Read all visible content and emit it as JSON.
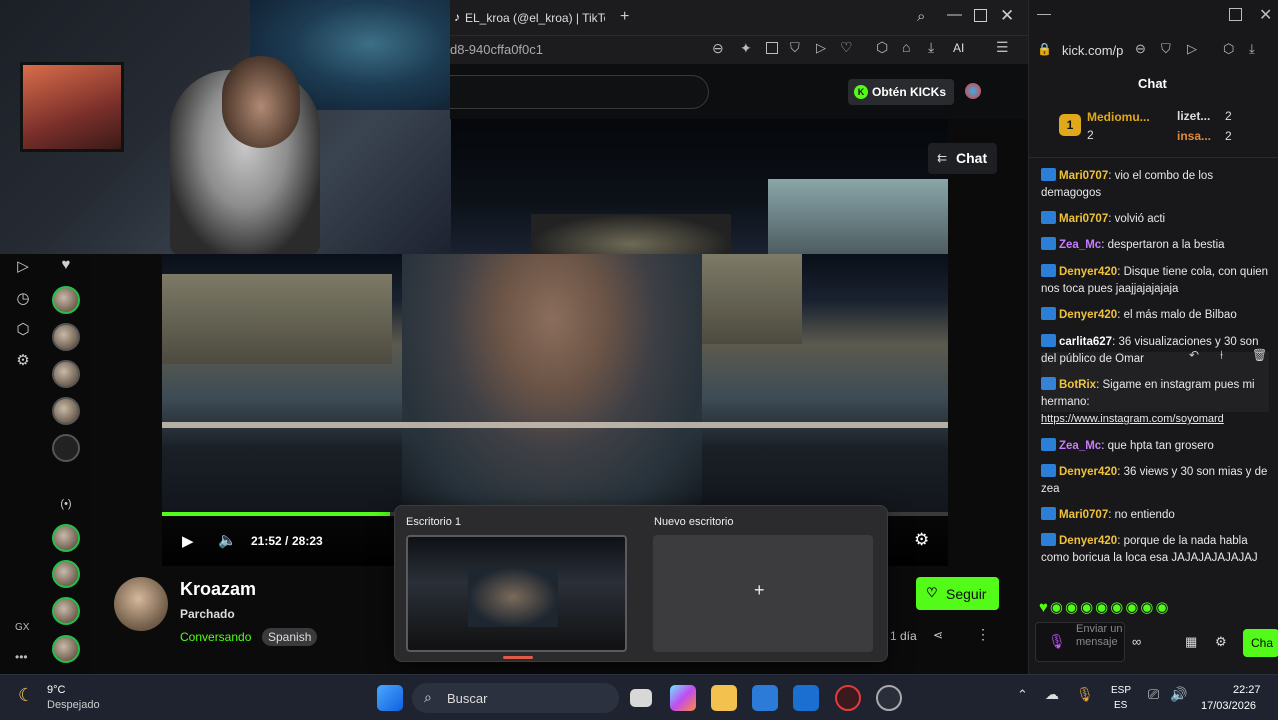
{
  "browser": {
    "tab_title": "EL_kroa (@el_kroa) | TikTo",
    "url_fragment": "d8-940cffa0f0c1",
    "ai_label": "AI"
  },
  "site": {
    "kicks_button": "Obtén KICKs",
    "chat_toggle": "Chat"
  },
  "player": {
    "current_time": "21:52",
    "separator": "/",
    "duration": "28:23",
    "progress": 0.29
  },
  "streamer": {
    "name": "Kroazam",
    "category": "Parchado",
    "status": "Conversando",
    "language": "Spanish",
    "follow": "Seguir",
    "age": "1 día"
  },
  "sidebar": {
    "gx": "GX"
  },
  "desktops": {
    "d1": "Escritorio 1",
    "d2": "Nuevo escritorio",
    "add": "+"
  },
  "chat": {
    "url": "kick.com/p",
    "title": "Chat",
    "leader": {
      "rank": "1",
      "name1": "Mediomu...",
      "count1": "2",
      "name2": "lizet...",
      "count2": "2",
      "name3": "insa...",
      "count3": "2"
    },
    "messages": [
      {
        "user": "Mari0707",
        "color": "#f0c23a",
        "text": "vio el combo de los demagogos"
      },
      {
        "user": "Mari0707",
        "color": "#f0c23a",
        "text": "volvió acti"
      },
      {
        "user": "Zea_Mc",
        "color": "#c77dff",
        "text": "despertaron a la bestia"
      },
      {
        "user": "Denyer420",
        "color": "#f0c23a",
        "text": "Disque tiene cola, con quien nos toca pues jaajjajajajaja"
      },
      {
        "user": "Denyer420",
        "color": "#f0c23a",
        "text": "el más malo de Bilbao"
      },
      {
        "user": "carlita627",
        "color": "#ffffff",
        "text": "36 visualizaciones y 30 son del público de Omar"
      },
      {
        "user": "BotRix",
        "color": "#f0c23a",
        "text": "Sigame en instagram pues mi hermano:"
      },
      {
        "user": "",
        "color": "#ffffff",
        "text": "https://www.instagram.com/soyomard"
      },
      {
        "user": "Zea_Mc",
        "color": "#c77dff",
        "text": "que hpta tan grosero"
      },
      {
        "user": "Denyer420",
        "color": "#f0c23a",
        "text": "36 views y 30 son mias y de zea"
      },
      {
        "user": "Mari0707",
        "color": "#f0c23a",
        "text": "no entiendo"
      },
      {
        "user": "Denyer420",
        "color": "#f0c23a",
        "text": "porque de la nada habla como boricua la loca esa JAJAJAJAJAJAJ"
      }
    ],
    "input_placeholder": "Enviar un mensaje",
    "send": "Cha"
  },
  "taskbar": {
    "weather_temp": "9°C",
    "weather_desc": "Despejado",
    "search": "Buscar",
    "lang1": "ESP",
    "lang2": "ES",
    "time": "22:27",
    "date": "17/03/2026"
  },
  "colors": {
    "accent": "#53fc18"
  }
}
